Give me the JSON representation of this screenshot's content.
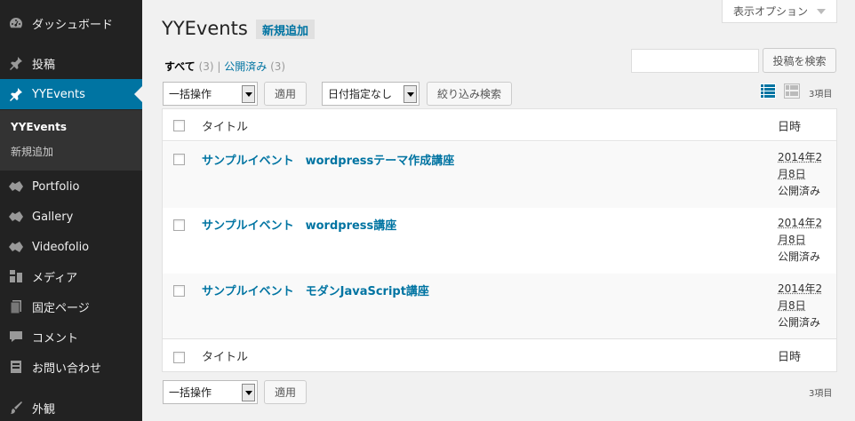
{
  "sidebar": {
    "menu": {
      "dashboard": "ダッシュボード",
      "posts": "投稿",
      "yyevents": "YYEvents",
      "portfolio": "Portfolio",
      "gallery": "Gallery",
      "videofolio": "Videofolio",
      "media": "メディア",
      "pages": "固定ページ",
      "comments": "コメント",
      "contact": "お問い合わせ",
      "appearance": "外観"
    },
    "submenu": {
      "all": "YYEvents",
      "add_new": "新規追加"
    },
    "colors": {
      "background": "#222222",
      "current": "#0074a2",
      "submenu": "#333333"
    }
  },
  "screen_options": {
    "label": "表示オプション"
  },
  "heading": {
    "title": "YYEvents",
    "add_new": "新規追加"
  },
  "subsubsub": {
    "all_label": "すべて",
    "all_count": "(3)",
    "separator": "|",
    "published_label": "公開済み",
    "published_count": "(3)"
  },
  "search": {
    "value": "",
    "button": "投稿を検索"
  },
  "tablenav_top": {
    "bulk_action": "一括操作",
    "apply": "適用",
    "date_filter": "日付指定なし",
    "filter_button": "絞り込み検索",
    "items_count": "3項目"
  },
  "view_modes": [
    "list-view-icon",
    "excerpt-view-icon"
  ],
  "table": {
    "header": {
      "title": "タイトル",
      "date": "日時"
    },
    "rows": [
      {
        "title": "サンプルイベント　wordpressテーマ作成講座",
        "date_line1": "2014年2",
        "date_line2": "月8日",
        "status": "公開済み"
      },
      {
        "title": "サンプルイベント　wordpress講座",
        "date_line1": "2014年2",
        "date_line2": "月8日",
        "status": "公開済み"
      },
      {
        "title": "サンプルイベント　モダンJavaScript講座",
        "date_line1": "2014年2",
        "date_line2": "月8日",
        "status": "公開済み"
      }
    ],
    "footer": {
      "title": "タイトル",
      "date": "日時"
    }
  },
  "tablenav_bottom": {
    "bulk_action": "一括操作",
    "apply": "適用",
    "items_count": "3項目"
  },
  "colors": {
    "link": "#0074a2",
    "page_bg": "#f1f1f1"
  }
}
